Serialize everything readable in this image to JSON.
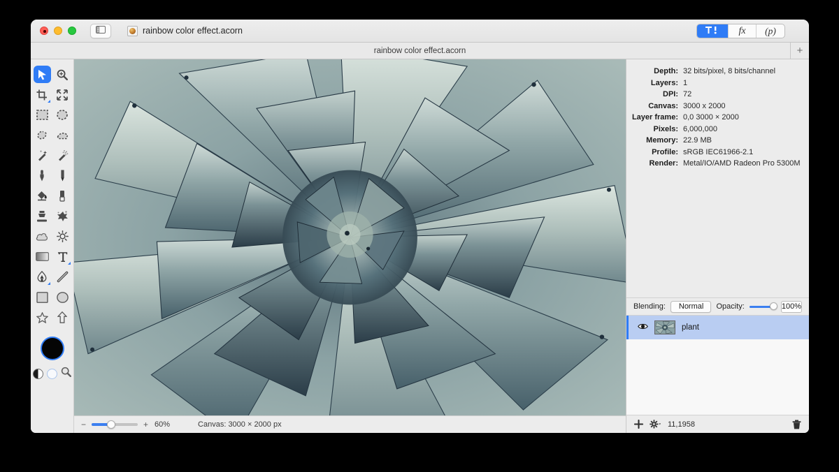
{
  "window": {
    "title": "rainbow color effect.acorn",
    "traffic_lights": [
      "close",
      "minimize",
      "zoom"
    ],
    "sidebar_toggle_icon": "sidebar-toggle-icon",
    "document_icon": "acorn-document-icon"
  },
  "segmented": [
    {
      "id": "tools",
      "label": "",
      "icon": "tools-inspector-icon",
      "active": true
    },
    {
      "id": "filters",
      "label": "fx",
      "icon": "fx-icon",
      "active": false
    },
    {
      "id": "palette",
      "label": "(p)",
      "icon": "palette-icon",
      "active": false
    }
  ],
  "tabbar": {
    "tab_title": "rainbow color effect.acorn",
    "new_tab_label": "+"
  },
  "tools": [
    {
      "name": "move-tool",
      "active": true
    },
    {
      "name": "zoom-tool",
      "active": false
    },
    {
      "name": "crop-tool",
      "active": false,
      "badge": true
    },
    {
      "name": "transform-tool",
      "active": false
    },
    {
      "name": "rectangular-select-tool",
      "active": false
    },
    {
      "name": "elliptical-select-tool",
      "active": false
    },
    {
      "name": "lasso-select-tool",
      "active": false
    },
    {
      "name": "polygon-select-tool",
      "active": false
    },
    {
      "name": "magic-wand-tool",
      "active": false
    },
    {
      "name": "instant-alpha-tool",
      "active": false
    },
    {
      "name": "paint-brush-tool",
      "active": false
    },
    {
      "name": "pencil-tool",
      "active": false
    },
    {
      "name": "paint-bucket-tool",
      "active": false
    },
    {
      "name": "eraser-tool",
      "active": false
    },
    {
      "name": "clone-stamp-tool",
      "active": false
    },
    {
      "name": "smudge-tool",
      "active": false
    },
    {
      "name": "blur-tool",
      "active": false
    },
    {
      "name": "dodge-burn-tool",
      "active": false
    },
    {
      "name": "gradient-tool",
      "active": false
    },
    {
      "name": "text-tool",
      "active": false,
      "badge": true
    },
    {
      "name": "bezier-pen-tool",
      "active": false,
      "badge": true
    },
    {
      "name": "line-tool",
      "active": false
    },
    {
      "name": "rectangle-shape-tool",
      "active": false
    },
    {
      "name": "ellipse-shape-tool",
      "active": false
    },
    {
      "name": "star-shape-tool",
      "active": false
    },
    {
      "name": "arrow-shape-tool",
      "active": false
    }
  ],
  "color_well": {
    "foreground": "#050505",
    "background": "#f7f9fc",
    "selection_ring": "#2f7cf6"
  },
  "zoombar": {
    "minus": "−",
    "plus": "+",
    "zoom_level": "60%",
    "canvas_size": "Canvas: 3000 × 2000 px"
  },
  "info": {
    "rows": [
      {
        "key": "Depth:",
        "value": "32 bits/pixel, 8 bits/channel"
      },
      {
        "key": "Layers:",
        "value": "1"
      },
      {
        "key": "DPI:",
        "value": "72"
      },
      {
        "key": "Canvas:",
        "value": "3000 x 2000"
      },
      {
        "key": "Layer frame:",
        "value": "0,0 3000 × 2000"
      },
      {
        "key": "Pixels:",
        "value": "6,000,000"
      },
      {
        "key": "Memory:",
        "value": "22.9 MB"
      },
      {
        "key": "Profile:",
        "value": "sRGB IEC61966-2.1"
      },
      {
        "key": "Render:",
        "value": "Metal/IO/AMD Radeon Pro 5300M"
      }
    ]
  },
  "blending": {
    "label": "Blending:",
    "mode": "Normal",
    "opacity_label": "Opacity:",
    "opacity_value": "100%"
  },
  "layers": [
    {
      "name": "plant",
      "visible": true,
      "selected": true
    }
  ],
  "layer_footer": {
    "add_icon": "plus-icon",
    "settings_icon": "gear-icon",
    "coordinates": "11,1958",
    "delete_icon": "trash-icon"
  },
  "artwork": {
    "subject": "agave succulent rosette",
    "palette": [
      "#b9c8c6",
      "#94a9aa",
      "#6e8489",
      "#3f555e",
      "#24333d",
      "#dde6e2"
    ]
  }
}
